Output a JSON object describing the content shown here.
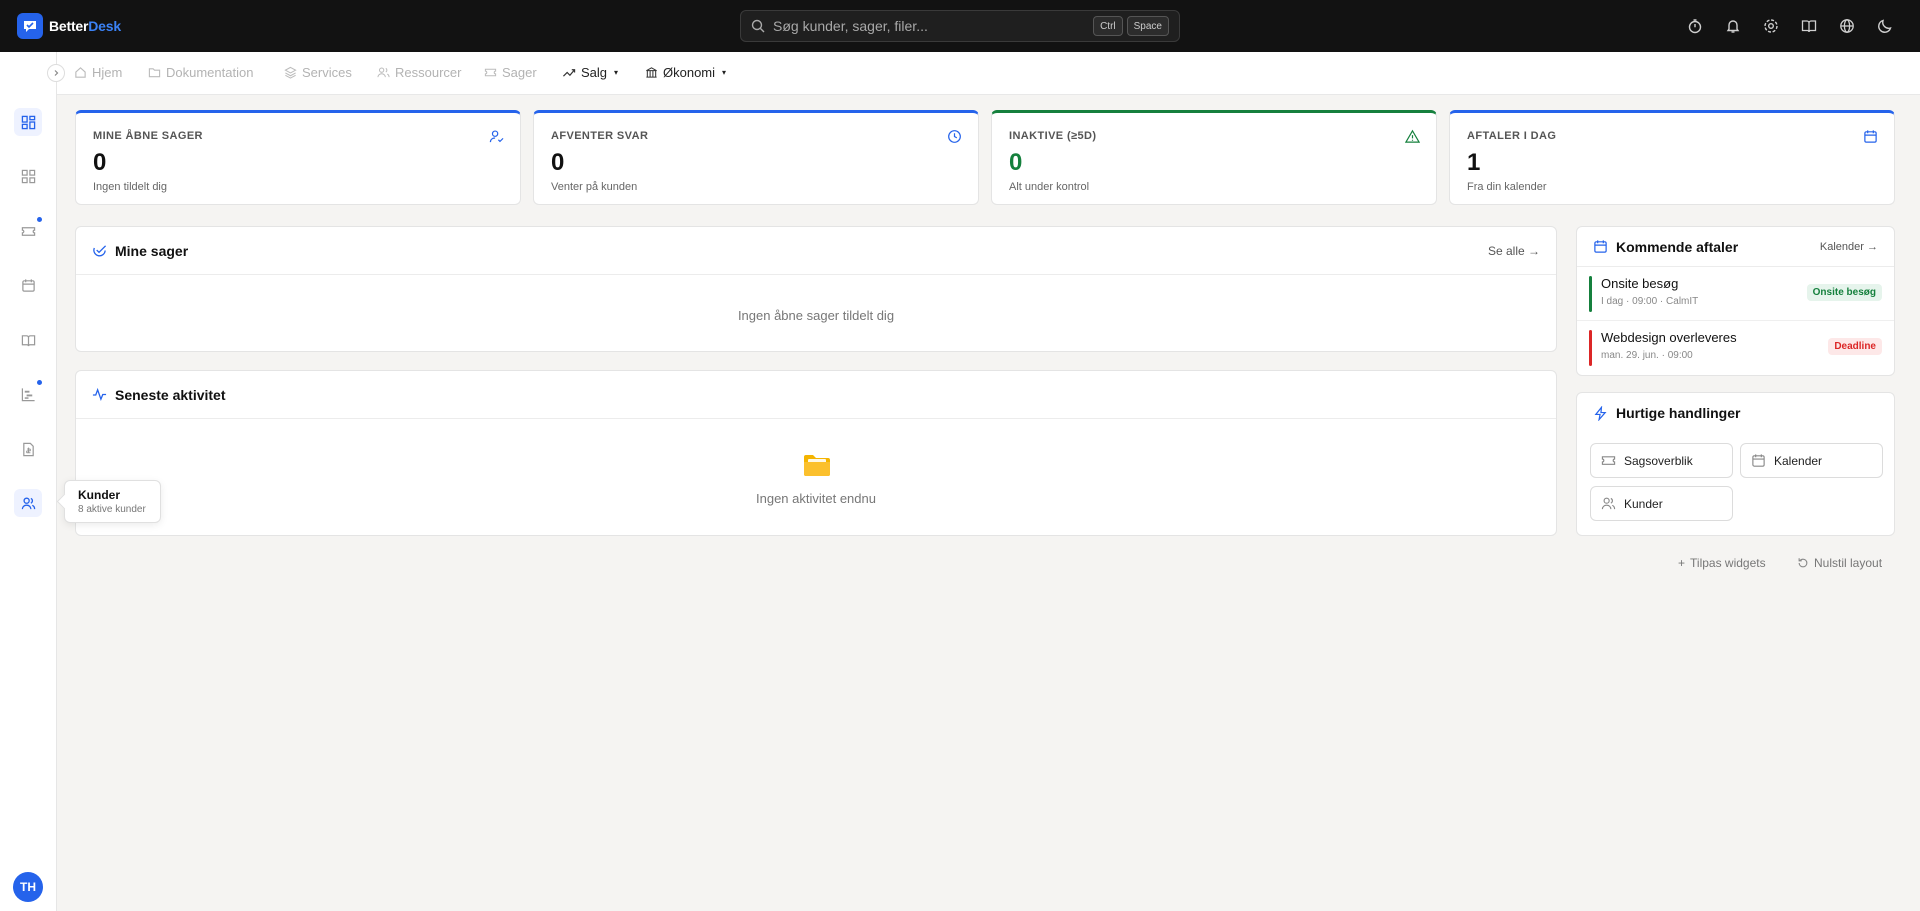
{
  "app": {
    "name_part1": "Better",
    "name_part2": "Desk"
  },
  "search": {
    "placeholder": "Søg kunder, sager, filer...",
    "shortcut_key1": "Ctrl",
    "shortcut_key2": "Space"
  },
  "topbar_icons": [
    "timer-icon",
    "bell-icon",
    "gear-icon",
    "book-icon",
    "globe-icon",
    "moon-icon"
  ],
  "nav": {
    "home": "Hjem",
    "docs": "Dokumentation",
    "services": "Services",
    "resources": "Ressourcer",
    "cases": "Sager",
    "sales": "Salg",
    "economy": "Økonomi"
  },
  "stats": [
    {
      "label": "MINE ÅBNE SAGER",
      "value": "0",
      "sub": "Ingen tildelt dig"
    },
    {
      "label": "AFVENTER SVAR",
      "value": "0",
      "sub": "Venter på kunden"
    },
    {
      "label": "INAKTIVE (≥5D)",
      "value": "0",
      "sub": "Alt under kontrol"
    },
    {
      "label": "AFTALER I DAG",
      "value": "1",
      "sub": "Fra din kalender"
    }
  ],
  "my_cases": {
    "title": "Mine sager",
    "link": "Se alle →",
    "empty": "Ingen åbne sager tildelt dig"
  },
  "activity": {
    "title": "Seneste aktivitet",
    "empty": "Ingen aktivitet endnu"
  },
  "appointments": {
    "title": "Kommende aftaler",
    "link": "Kalender →",
    "items": [
      {
        "title": "Onsite besøg",
        "meta": "I dag · 09:00 · CalmIT",
        "badge": "Onsite besøg",
        "color": "#15803d"
      },
      {
        "title": "Webdesign overleveres",
        "meta": "man. 29. jun. · 09:00",
        "badge": "Deadline",
        "color": "#dc2626"
      }
    ]
  },
  "quick_actions": {
    "title": "Hurtige handlinger",
    "buttons": [
      "Sagsoverblik",
      "Kalender",
      "Kunder"
    ]
  },
  "footer": {
    "customize": "Tilpas widgets",
    "reset": "Nulstil layout"
  },
  "tooltip": {
    "title": "Kunder",
    "sub": "8 aktive kunder"
  },
  "user": {
    "initials": "TH"
  },
  "colors": {
    "accent": "#2563eb",
    "success": "#15803d",
    "danger": "#dc2626",
    "topbar": "#121212"
  }
}
